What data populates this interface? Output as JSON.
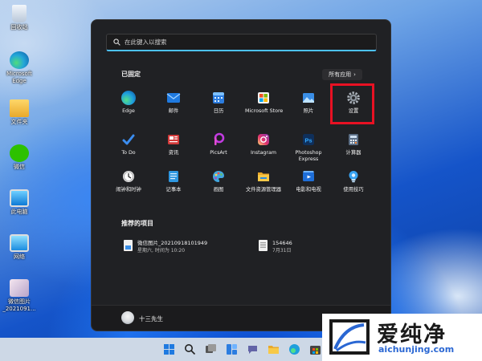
{
  "desktop": {
    "icons": [
      {
        "label": "回收站",
        "icon": "recycle-bin-icon"
      },
      {
        "label": "Microsoft Edge",
        "icon": "edge-icon"
      },
      {
        "label": "文件夹",
        "icon": "folder-icon"
      },
      {
        "label": "微信",
        "icon": "wechat-icon"
      },
      {
        "label": "此电脑",
        "icon": "computer-icon"
      },
      {
        "label": "网络",
        "icon": "network-icon"
      },
      {
        "label": "微信图片_2021091...",
        "icon": "image-file-icon"
      }
    ]
  },
  "start_menu": {
    "search": {
      "placeholder": "在此键入以搜索"
    },
    "pinned_title": "已固定",
    "all_apps_label": "所有应用",
    "pinned_apps": [
      {
        "label": "Edge",
        "icon": "edge-icon",
        "color": "#1e90d8"
      },
      {
        "label": "邮件",
        "icon": "mail-icon",
        "color": "#1f7ae0"
      },
      {
        "label": "日历",
        "icon": "calendar-icon",
        "color": "#2c7de0"
      },
      {
        "label": "Microsoft Store",
        "icon": "store-icon",
        "color": "#ffffff"
      },
      {
        "label": "照片",
        "icon": "photos-icon",
        "color": "#3a8ee6"
      },
      {
        "label": "设置",
        "icon": "gear-icon",
        "color": "#9aa0a6"
      },
      {
        "label": "To Do",
        "icon": "todo-check-icon",
        "color": "#2f7de8"
      },
      {
        "label": "资讯",
        "icon": "news-icon",
        "color": "#d33b3b"
      },
      {
        "label": "PicsArt",
        "icon": "picsart-icon",
        "color": "#c13be0"
      },
      {
        "label": "Instagram",
        "icon": "instagram-icon",
        "color": "#e1306c"
      },
      {
        "label": "Photoshop Express",
        "icon": "photoshop-icon",
        "color": "#0f2f5a"
      },
      {
        "label": "计算器",
        "icon": "calculator-icon",
        "color": "#5c6f86"
      },
      {
        "label": "闹钟和时钟",
        "icon": "clock-icon",
        "color": "#eaeaea"
      },
      {
        "label": "记事本",
        "icon": "notepad-icon",
        "color": "#2e97e0"
      },
      {
        "label": "画图",
        "icon": "paint-icon",
        "color": "#41a6df"
      },
      {
        "label": "文件资源管理器",
        "icon": "file-explorer-icon",
        "color": "#f2c34d"
      },
      {
        "label": "电影和电视",
        "icon": "movies-icon",
        "color": "#1e6ed8"
      },
      {
        "label": "使用技巧",
        "icon": "tips-lightbulb-icon",
        "color": "#38a3f2"
      }
    ],
    "recommended_title": "推荐的项目",
    "recommended": [
      {
        "name": "微信图片_20210918101949",
        "meta": "星期六, 时间为 10:20",
        "icon": "image-file-icon"
      },
      {
        "name": "154646",
        "meta": "7月31日",
        "icon": "text-file-icon"
      }
    ],
    "user": {
      "name": "十三先生"
    }
  },
  "taskbar": {
    "icons": [
      "start-icon",
      "search-icon",
      "task-view-icon",
      "widgets-icon",
      "teams-chat-icon",
      "file-explorer-icon",
      "edge-icon",
      "store-icon"
    ]
  },
  "watermark": {
    "text_cn": "爱纯净",
    "text_en": "aichunjing.com"
  },
  "colors": {
    "accent": "#4cc2ff",
    "highlight": "#e81123",
    "menu_bg": "#202124"
  }
}
